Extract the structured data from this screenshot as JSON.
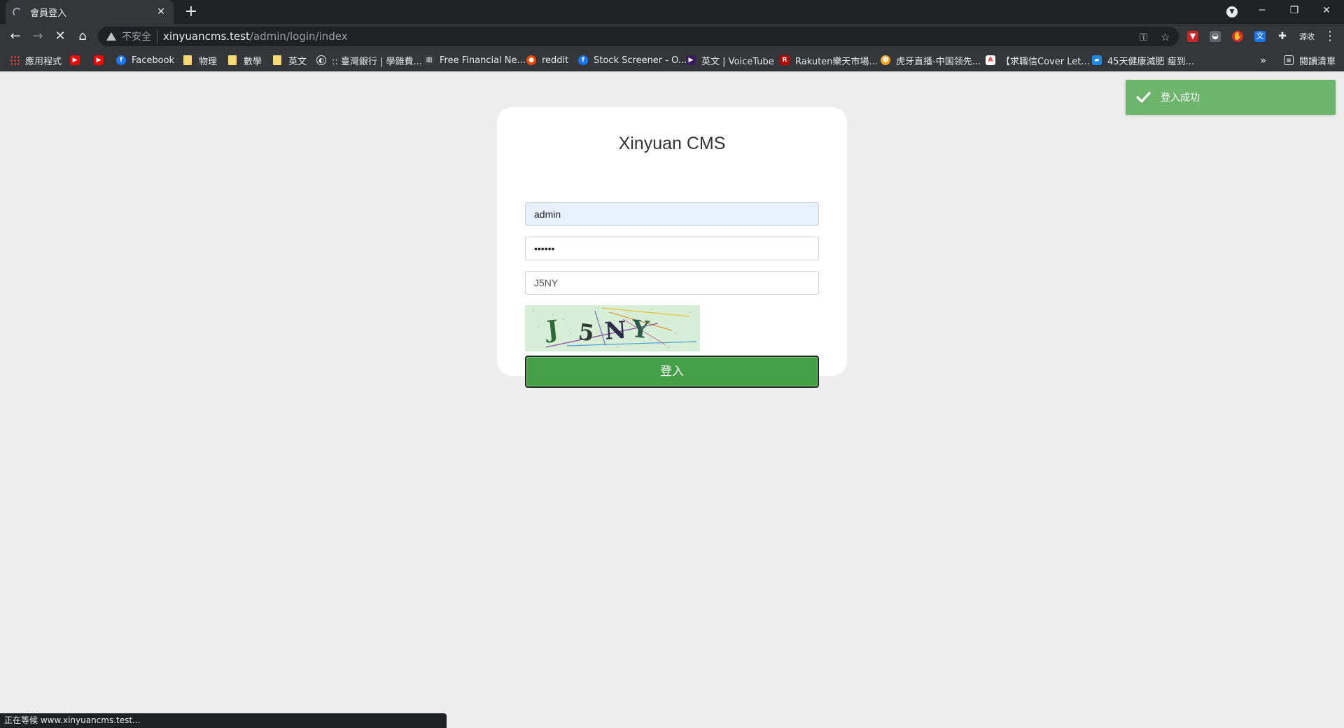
{
  "browser": {
    "tab_title": "會員登入",
    "tab_close": "✕",
    "new_tab": "+",
    "window_controls": {
      "minimize": "─",
      "restore": "❐",
      "close": "✕"
    },
    "nav": {
      "back": "←",
      "forward": "→",
      "stop": "✕",
      "home": "⌂"
    },
    "address": {
      "security_label": "不安全",
      "host": "xinyuancms.test",
      "path": "/admin/login/index"
    },
    "omnibox_icons": {
      "key": "⚿",
      "star": "☆"
    },
    "extensions_label": "源收",
    "menu": "⋮",
    "bookmarks": [
      {
        "label": "應用程式",
        "icon": "apps-grid-icon"
      },
      {
        "label": "",
        "icon": "youtube-icon",
        "color": "#ff0000"
      },
      {
        "label": "",
        "icon": "youtube-icon",
        "color": "#ff0000"
      },
      {
        "label": "Facebook",
        "icon": "facebook-icon",
        "color": "#1877f2"
      },
      {
        "label": "物理",
        "icon": "folder-icon"
      },
      {
        "label": "數學",
        "icon": "folder-icon"
      },
      {
        "label": "英文",
        "icon": "folder-icon"
      },
      {
        "label": ":: 臺灣銀行 | 學雜費...",
        "icon": "globe-icon"
      },
      {
        "label": "Free Financial Ne...",
        "icon": "chart-icon"
      },
      {
        "label": "reddit",
        "icon": "reddit-icon",
        "color": "#ff4500"
      },
      {
        "label": "Stock Screener - O...",
        "icon": "finviz-icon",
        "color": "#1877f2"
      },
      {
        "label": "英文 | VoiceTube",
        "icon": "voicetube-icon",
        "color": "#3b1c5a"
      },
      {
        "label": "Rakuten樂天市場...",
        "icon": "rakuten-icon",
        "color": "#bf0000"
      },
      {
        "label": "虎牙直播-中国领先...",
        "icon": "huya-icon",
        "color": "#f5a623"
      },
      {
        "label": "【求職信Cover Let...",
        "icon": "pdf-icon",
        "color": "#e53935"
      },
      {
        "label": "45天健康減肥 瘦到...",
        "icon": "article-icon",
        "color": "#1e88e5"
      }
    ],
    "bookmarks_overflow": "»",
    "reading_list": "閱讀清單",
    "status_text": "正在等候 www.xinyuancms.test..."
  },
  "login": {
    "title": "Xinyuan CMS",
    "username": "admin",
    "password_masked": "••••••",
    "captcha_input": "J5NY",
    "captcha_chars": [
      "J",
      "5",
      "N",
      "Y"
    ],
    "submit_label": "登入"
  },
  "toast": {
    "message": "登入成功",
    "color": "#6db56d"
  },
  "colors": {
    "primary_button": "#43a047",
    "page_background": "#ededed",
    "autofill_background": "#e8f0fe"
  }
}
